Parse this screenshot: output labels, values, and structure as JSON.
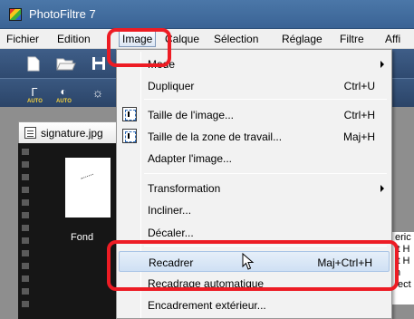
{
  "window": {
    "title": "PhotoFiltre 7"
  },
  "menubar": {
    "items": [
      {
        "label": "Fichier",
        "active": false
      },
      {
        "label": "Edition",
        "active": false
      },
      {
        "label": "Image",
        "active": true
      },
      {
        "label": "Calque",
        "active": false
      },
      {
        "label": "Sélection",
        "active": false
      },
      {
        "label": "Réglage",
        "active": false
      },
      {
        "label": "Filtre",
        "active": false
      },
      {
        "label": "Affi",
        "active": false
      }
    ]
  },
  "toolbar": {
    "icons": [
      "new-document-icon",
      "open-folder-icon",
      "save-icon"
    ],
    "auto_label": "AUTO"
  },
  "document": {
    "tab_label": "signature.jpg",
    "layer_label": "Fond",
    "side_text": [
      "eric",
      "it H",
      "it H",
      "n",
      "fect"
    ]
  },
  "image_menu": {
    "items": [
      {
        "label": "Mode",
        "shortcut": "",
        "submenu": true
      },
      {
        "label": "Dupliquer",
        "shortcut": "Ctrl+U"
      },
      {
        "label": "Taille de l'image...",
        "shortcut": "Ctrl+H",
        "icon": "image-size-icon"
      },
      {
        "label": "Taille de la zone de travail...",
        "shortcut": "Maj+H",
        "icon": "canvas-size-icon"
      },
      {
        "label": "Adapter l'image...",
        "shortcut": ""
      },
      {
        "label": "Transformation",
        "shortcut": "",
        "submenu": true
      },
      {
        "label": "Incliner...",
        "shortcut": ""
      },
      {
        "label": "Décaler...",
        "shortcut": ""
      },
      {
        "label": "Recadrer",
        "shortcut": "Maj+Ctrl+H",
        "highlighted": true
      },
      {
        "label": "Recadrage automatique",
        "shortcut": ""
      },
      {
        "label": "Encadrement extérieur...",
        "shortcut": ""
      }
    ]
  },
  "colors": {
    "titlebar": "#3a6395",
    "toolbar": "#2f4a70",
    "menu_background": "#f2f2f2",
    "highlight": "#cfe0f4",
    "annotation": "#ed1c24"
  }
}
